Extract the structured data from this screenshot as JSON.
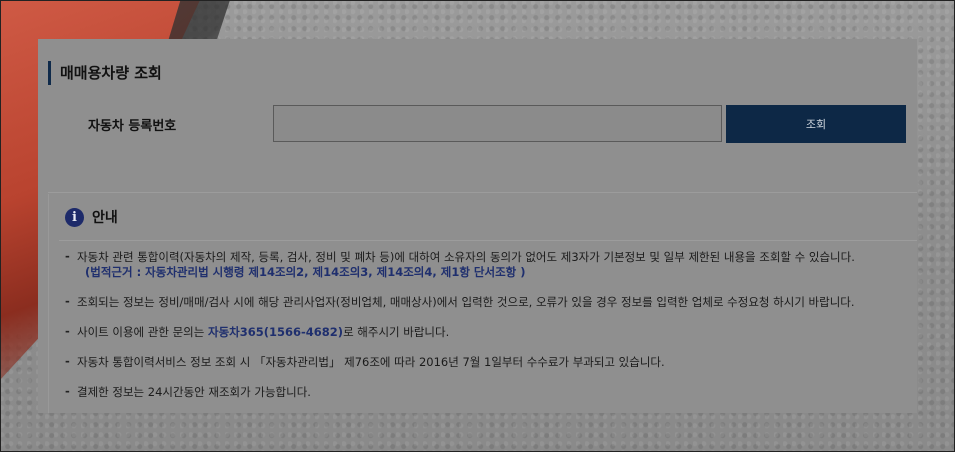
{
  "section_title": "매매용차량 조회",
  "search": {
    "label": "자동차 등록번호",
    "input_value": "",
    "button_label": "조회"
  },
  "info": {
    "title": "안내",
    "icon": "info-icon",
    "notes": {
      "n1": {
        "text": "자동차 관련 통합이력(자동차의 제작, 등록, 검사, 정비 및 폐차 등)에 대하여 소유자의 동의가 없어도 제3자가 기본정보 및 일부 제한된 내용을 조회할 수 있습니다.",
        "sub": "(법적근거 : 자동차관리법 시행령 제14조의2, 제14조의3, 제14조의4, 제1항 단서조항 )"
      },
      "n2": {
        "text": "조회되는 정보는 정비/매매/검사 시에 해당 관리사업자(정비업체, 매매상사)에서 입력한 것으로, 오류가 있을 경우 정보를 입력한 업체로 수정요청 하시기 바랍니다."
      },
      "n3": {
        "before": "사이트 이용에 관한 문의는 ",
        "highlight": "자동차365(1566-4682)",
        "after": "로 해주시기 바랍니다."
      },
      "n4": {
        "text": "자동차 통합이력서비스 정보 조회 시 「자동차관리법」 제76조에 따라 2016년 7월 1일부터 수수료가 부과되고 있습니다."
      },
      "n5": {
        "text": "결제한 정보는 24시간동안 재조회가 가능합니다."
      }
    }
  },
  "colors": {
    "accent": "#0d2846",
    "highlight_text": "#1f2f6e",
    "overlay": "#8f8f8f"
  }
}
